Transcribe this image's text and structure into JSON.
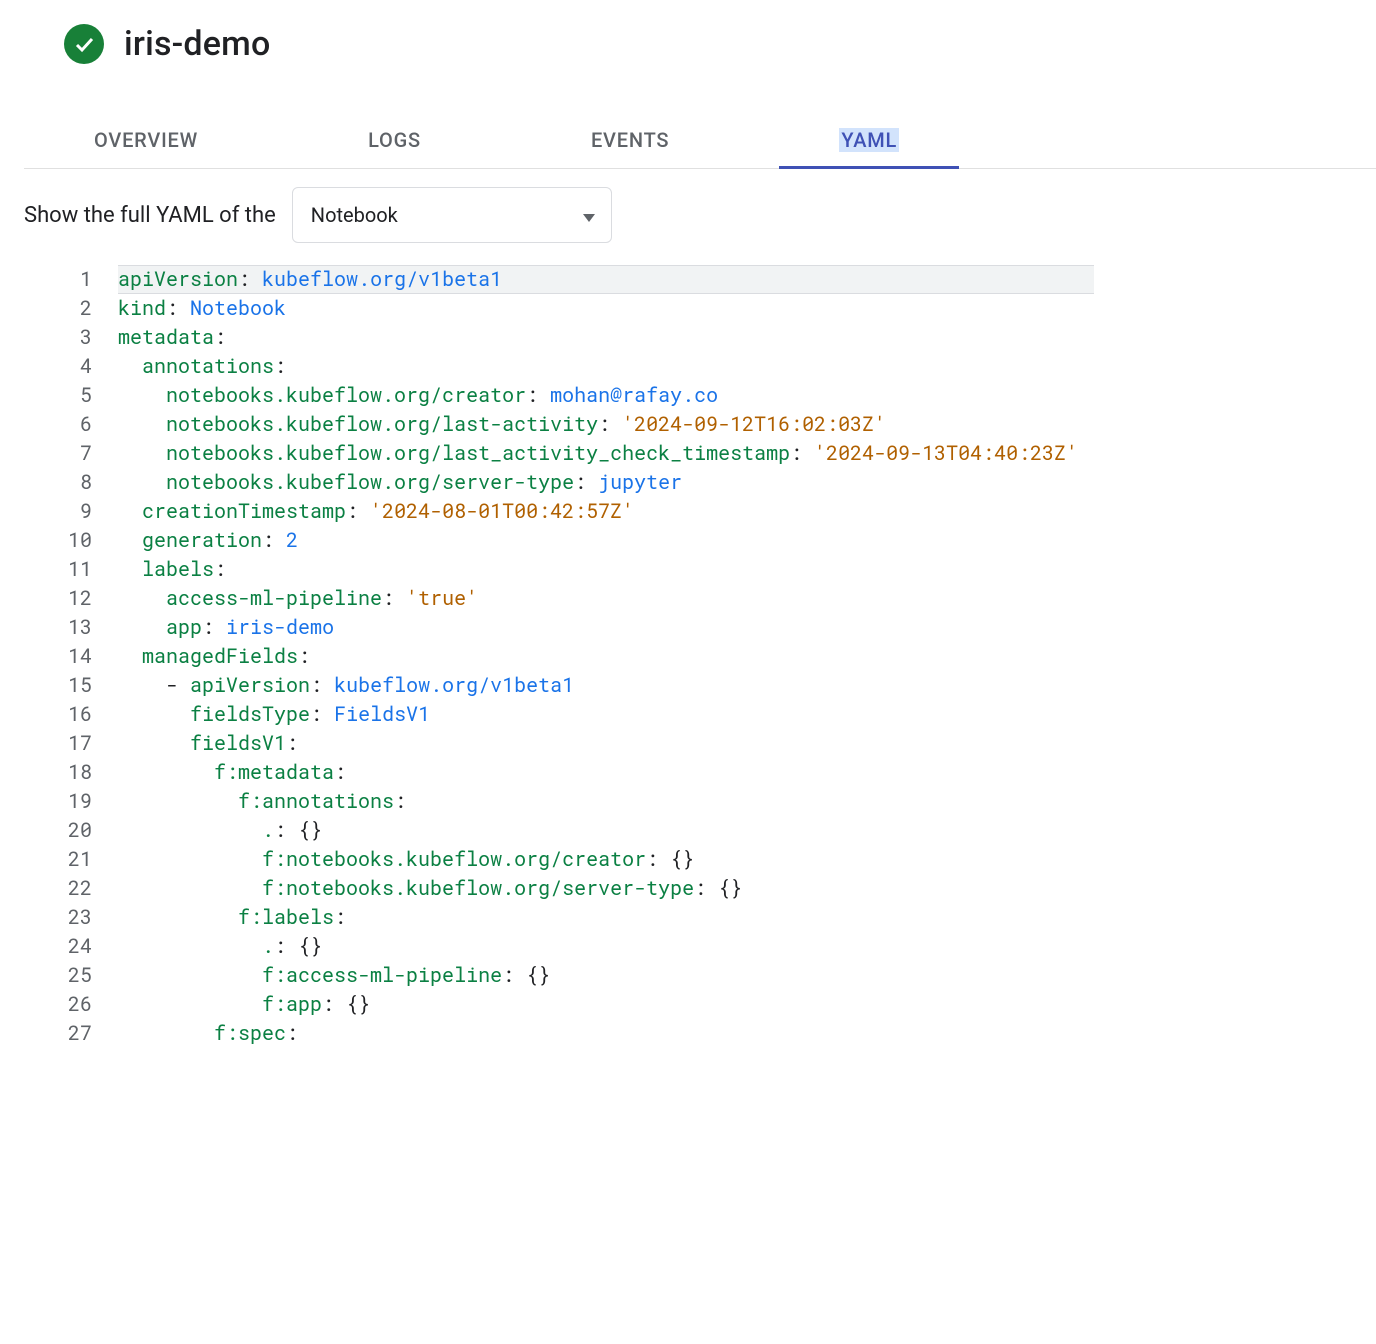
{
  "header": {
    "title": "iris-demo",
    "status_icon": "check-circle-icon"
  },
  "tabs": {
    "items": [
      {
        "label": "OVERVIEW",
        "active": false
      },
      {
        "label": "LOGS",
        "active": false
      },
      {
        "label": "EVENTS",
        "active": false
      },
      {
        "label": "YAML",
        "active": true
      }
    ]
  },
  "filter": {
    "prefix_text": "Show the full YAML of the",
    "select_value": "Notebook"
  },
  "yaml_lines": [
    {
      "n": 1,
      "indent": 0,
      "segments": [
        {
          "cls": "k",
          "t": "apiVersion"
        },
        {
          "cls": "punc",
          "t": ": "
        },
        {
          "cls": "v",
          "t": "kubeflow.org/v1beta1"
        }
      ]
    },
    {
      "n": 2,
      "indent": 0,
      "segments": [
        {
          "cls": "k",
          "t": "kind"
        },
        {
          "cls": "punc",
          "t": ": "
        },
        {
          "cls": "v",
          "t": "Notebook"
        }
      ]
    },
    {
      "n": 3,
      "indent": 0,
      "segments": [
        {
          "cls": "k",
          "t": "metadata"
        },
        {
          "cls": "punc",
          "t": ":"
        }
      ]
    },
    {
      "n": 4,
      "indent": 1,
      "segments": [
        {
          "cls": "k",
          "t": "annotations"
        },
        {
          "cls": "punc",
          "t": ":"
        }
      ]
    },
    {
      "n": 5,
      "indent": 2,
      "segments": [
        {
          "cls": "k",
          "t": "notebooks.kubeflow.org/creator"
        },
        {
          "cls": "punc",
          "t": ": "
        },
        {
          "cls": "v",
          "t": "mohan@rafay.co"
        }
      ]
    },
    {
      "n": 6,
      "indent": 2,
      "segments": [
        {
          "cls": "k",
          "t": "notebooks.kubeflow.org/last-activity"
        },
        {
          "cls": "punc",
          "t": ": "
        },
        {
          "cls": "s",
          "t": "'2024-09-12T16:02:03Z'"
        }
      ]
    },
    {
      "n": 7,
      "indent": 2,
      "segments": [
        {
          "cls": "k",
          "t": "notebooks.kubeflow.org/last_activity_check_timestamp"
        },
        {
          "cls": "punc",
          "t": ": "
        },
        {
          "cls": "s",
          "t": "'2024-09-13T04:40:23Z'"
        }
      ]
    },
    {
      "n": 8,
      "indent": 2,
      "segments": [
        {
          "cls": "k",
          "t": "notebooks.kubeflow.org/server-type"
        },
        {
          "cls": "punc",
          "t": ": "
        },
        {
          "cls": "v",
          "t": "jupyter"
        }
      ]
    },
    {
      "n": 9,
      "indent": 1,
      "segments": [
        {
          "cls": "k",
          "t": "creationTimestamp"
        },
        {
          "cls": "punc",
          "t": ": "
        },
        {
          "cls": "s",
          "t": "'2024-08-01T00:42:57Z'"
        }
      ]
    },
    {
      "n": 10,
      "indent": 1,
      "segments": [
        {
          "cls": "k",
          "t": "generation"
        },
        {
          "cls": "punc",
          "t": ": "
        },
        {
          "cls": "v",
          "t": "2"
        }
      ]
    },
    {
      "n": 11,
      "indent": 1,
      "segments": [
        {
          "cls": "k",
          "t": "labels"
        },
        {
          "cls": "punc",
          "t": ":"
        }
      ]
    },
    {
      "n": 12,
      "indent": 2,
      "segments": [
        {
          "cls": "k",
          "t": "access-ml-pipeline"
        },
        {
          "cls": "punc",
          "t": ": "
        },
        {
          "cls": "s",
          "t": "'true'"
        }
      ]
    },
    {
      "n": 13,
      "indent": 2,
      "segments": [
        {
          "cls": "k",
          "t": "app"
        },
        {
          "cls": "punc",
          "t": ": "
        },
        {
          "cls": "v",
          "t": "iris-demo"
        }
      ]
    },
    {
      "n": 14,
      "indent": 1,
      "segments": [
        {
          "cls": "k",
          "t": "managedFields"
        },
        {
          "cls": "punc",
          "t": ":"
        }
      ]
    },
    {
      "n": 15,
      "indent": 2,
      "segments": [
        {
          "cls": "punc",
          "t": "- "
        },
        {
          "cls": "k",
          "t": "apiVersion"
        },
        {
          "cls": "punc",
          "t": ": "
        },
        {
          "cls": "v",
          "t": "kubeflow.org/v1beta1"
        }
      ]
    },
    {
      "n": 16,
      "indent": 3,
      "segments": [
        {
          "cls": "k",
          "t": "fieldsType"
        },
        {
          "cls": "punc",
          "t": ": "
        },
        {
          "cls": "v",
          "t": "FieldsV1"
        }
      ]
    },
    {
      "n": 17,
      "indent": 3,
      "segments": [
        {
          "cls": "k",
          "t": "fieldsV1"
        },
        {
          "cls": "punc",
          "t": ":"
        }
      ]
    },
    {
      "n": 18,
      "indent": 4,
      "segments": [
        {
          "cls": "k",
          "t": "f:metadata"
        },
        {
          "cls": "punc",
          "t": ":"
        }
      ]
    },
    {
      "n": 19,
      "indent": 5,
      "segments": [
        {
          "cls": "k",
          "t": "f:annotations"
        },
        {
          "cls": "punc",
          "t": ":"
        }
      ]
    },
    {
      "n": 20,
      "indent": 6,
      "segments": [
        {
          "cls": "k",
          "t": "."
        },
        {
          "cls": "punc",
          "t": ": "
        },
        {
          "cls": "punc",
          "t": "{}"
        }
      ]
    },
    {
      "n": 21,
      "indent": 6,
      "segments": [
        {
          "cls": "k",
          "t": "f:notebooks.kubeflow.org/creator"
        },
        {
          "cls": "punc",
          "t": ": "
        },
        {
          "cls": "punc",
          "t": "{}"
        }
      ]
    },
    {
      "n": 22,
      "indent": 6,
      "segments": [
        {
          "cls": "k",
          "t": "f:notebooks.kubeflow.org/server-type"
        },
        {
          "cls": "punc",
          "t": ": "
        },
        {
          "cls": "punc",
          "t": "{}"
        }
      ]
    },
    {
      "n": 23,
      "indent": 5,
      "segments": [
        {
          "cls": "k",
          "t": "f:labels"
        },
        {
          "cls": "punc",
          "t": ":"
        }
      ]
    },
    {
      "n": 24,
      "indent": 6,
      "segments": [
        {
          "cls": "k",
          "t": "."
        },
        {
          "cls": "punc",
          "t": ": "
        },
        {
          "cls": "punc",
          "t": "{}"
        }
      ]
    },
    {
      "n": 25,
      "indent": 6,
      "segments": [
        {
          "cls": "k",
          "t": "f:access-ml-pipeline"
        },
        {
          "cls": "punc",
          "t": ": "
        },
        {
          "cls": "punc",
          "t": "{}"
        }
      ]
    },
    {
      "n": 26,
      "indent": 6,
      "segments": [
        {
          "cls": "k",
          "t": "f:app"
        },
        {
          "cls": "punc",
          "t": ": "
        },
        {
          "cls": "punc",
          "t": "{}"
        }
      ]
    },
    {
      "n": 27,
      "indent": 4,
      "segments": [
        {
          "cls": "k",
          "t": "f:spec"
        },
        {
          "cls": "punc",
          "t": ":"
        }
      ]
    }
  ]
}
